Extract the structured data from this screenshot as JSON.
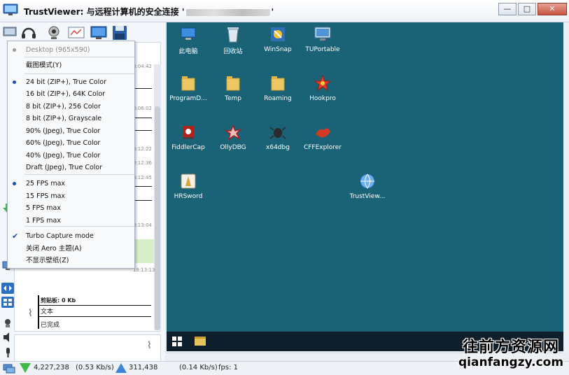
{
  "window": {
    "title_prefix": "TrustViewer: 与远程计算机的安全连接 '",
    "title_suffix": "'",
    "min": "—",
    "max": "□",
    "close": "✕"
  },
  "menu": {
    "items": [
      {
        "label": "Desktop (965x590)",
        "mark": "dot-grey",
        "disabled": true
      },
      {
        "label": "截图模式(Y)",
        "mark": "none"
      },
      {
        "label": "24 bit (ZIP+), True Color",
        "mark": "dot"
      },
      {
        "label": "16 bit (ZIP+), 64K Color",
        "mark": "none"
      },
      {
        "label": " 8 bit (ZIP+), 256 Color",
        "mark": "none"
      },
      {
        "label": " 8 bit (ZIP+), Grayscale",
        "mark": "none"
      },
      {
        "label": "90% (Jpeg), True Color",
        "mark": "none"
      },
      {
        "label": "60% (Jpeg), True Color",
        "mark": "none"
      },
      {
        "label": "40% (Jpeg), True Color",
        "mark": "none"
      },
      {
        "label": "Draft (Jpeg), True Color",
        "mark": "none"
      },
      {
        "label": "25 FPS max",
        "mark": "dot"
      },
      {
        "label": "15 FPS max",
        "mark": "none"
      },
      {
        "label": "  5 FPS max",
        "mark": "none"
      },
      {
        "label": "  1 FPS max",
        "mark": "none"
      },
      {
        "label": "Turbo Capture mode",
        "mark": "check"
      },
      {
        "label": "关闭 Aero 主题(A)",
        "mark": "none"
      },
      {
        "label": "不显示壁纸(Z)",
        "mark": "none"
      }
    ]
  },
  "chat": {
    "timestamps": [
      "8:04:42",
      "8:06:02",
      "8:12:22",
      "8:12:36",
      "8:12:45",
      "8:13:04",
      "18:13:13"
    ],
    "clipboard_label": "剪贴板: 0 Kb",
    "clipboard_type": "文本",
    "clipboard_status": "已完成"
  },
  "desktop": {
    "icons": [
      {
        "label": "此电脑",
        "kind": "pc"
      },
      {
        "label": "回收站",
        "kind": "bin"
      },
      {
        "label": "WinSnap",
        "kind": "snap"
      },
      {
        "label": "TUPortable",
        "kind": "tu"
      },
      {
        "label": "ProgramD...",
        "kind": "folder"
      },
      {
        "label": "Temp",
        "kind": "folder"
      },
      {
        "label": "Roaming",
        "kind": "folder"
      },
      {
        "label": "Hookpro",
        "kind": "hook"
      },
      {
        "label": "FiddlerCap",
        "kind": "fiddler"
      },
      {
        "label": "OllyDBG",
        "kind": "olly"
      },
      {
        "label": "x64dbg",
        "kind": "x64"
      },
      {
        "label": "CFFExplorer",
        "kind": "cff"
      },
      {
        "label": "HRSword",
        "kind": "hr"
      },
      {
        "label": "TrustView...",
        "kind": "globe"
      }
    ]
  },
  "status": {
    "down_bytes": "4,227,238",
    "down_rate": "(0.53 Kb/s)",
    "up_bytes": "311,438",
    "up_rate": "(0.14 Kb/s)",
    "fps": "fps: 1"
  },
  "watermark": {
    "line1": "往前方资源网",
    "line2": "qianfangzy.com"
  },
  "colors": {
    "desktop_bg": "#1a6377",
    "taskbar": "#0e1e2b",
    "menu_mark": "#1a4fb8"
  }
}
